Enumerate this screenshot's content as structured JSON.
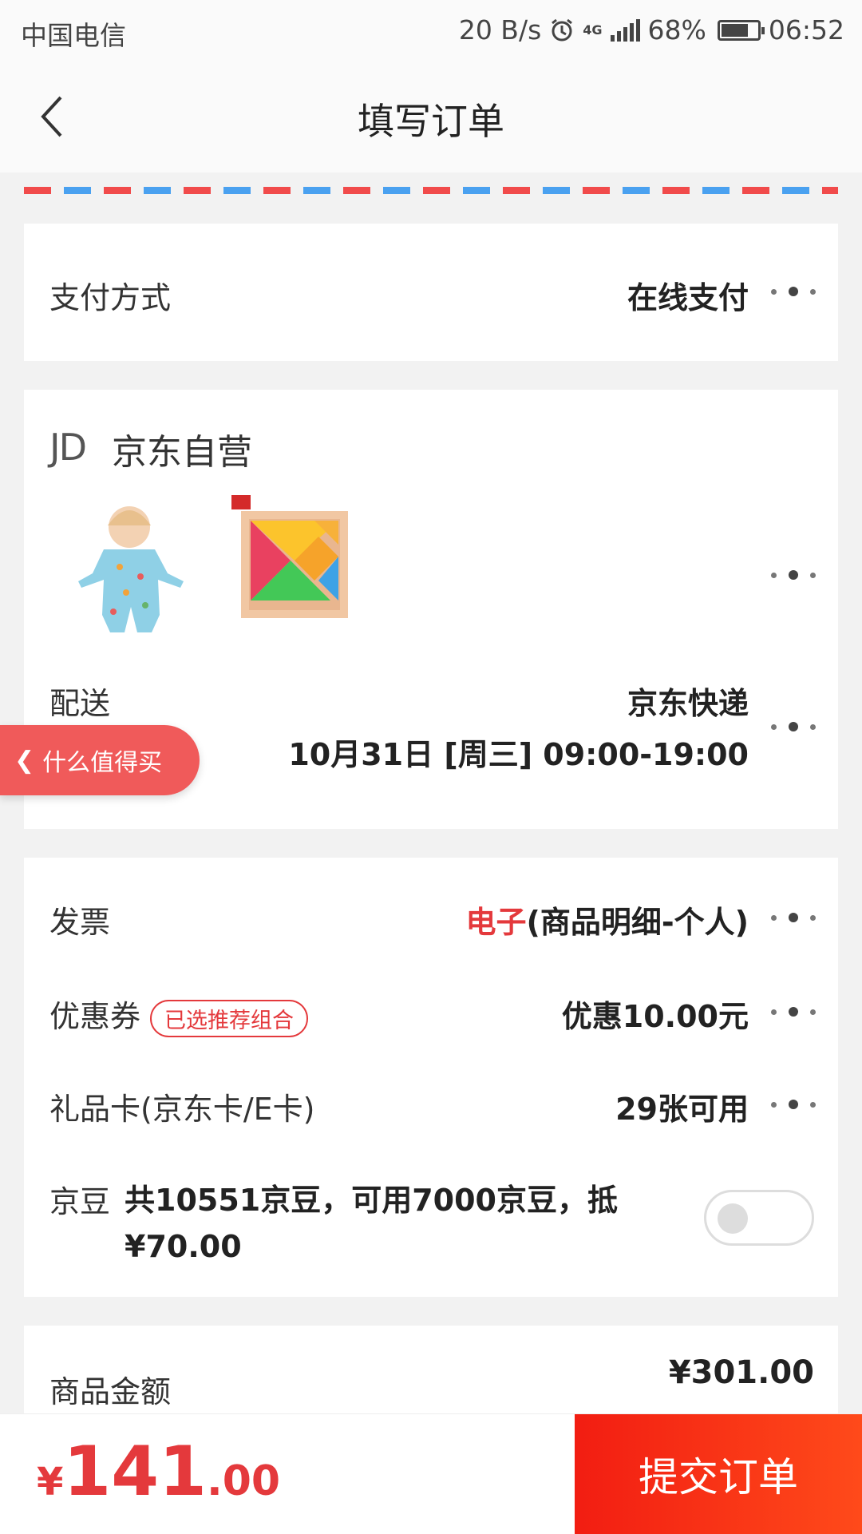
{
  "status_bar": {
    "carrier": "中国电信",
    "net_speed": "20 B/s",
    "network": "4G",
    "battery": "68%",
    "time": "06:52"
  },
  "nav": {
    "title": "填写订单"
  },
  "payment": {
    "label": "支付方式",
    "value": "在线支付"
  },
  "store": {
    "logo": "JD",
    "name": "京东自营"
  },
  "delivery": {
    "label": "配送",
    "carrier": "京东快递",
    "time": "10月31日 [周三] 09:00-19:00"
  },
  "float_tag": {
    "label": "什么值得买"
  },
  "invoice": {
    "label": "发票",
    "value_highlight": "电子",
    "value_rest": "(商品明细-个人)"
  },
  "coupon": {
    "label": "优惠券",
    "tag": "已选推荐组合",
    "value": "优惠10.00元"
  },
  "gift_card": {
    "label": "礼品卡(京东卡/E卡)",
    "value": "29张可用"
  },
  "jingdou": {
    "label": "京豆",
    "text": "共10551京豆，可用7000京豆，抵¥70.00",
    "enabled": false
  },
  "amount": {
    "label": "商品金额",
    "value": "¥301.00"
  },
  "bottom": {
    "currency": "¥",
    "total_int": "141",
    "total_dec": ".00",
    "submit": "提交订单"
  },
  "colors": {
    "accent": "#e4393c",
    "float_tag": "#f05a5a"
  }
}
